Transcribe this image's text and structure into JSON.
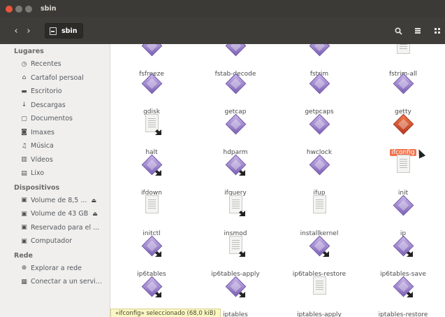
{
  "window": {
    "title": "sbin"
  },
  "toolbar": {
    "path_label": "sbin"
  },
  "sidebar": {
    "sections": [
      {
        "title": "Lugares",
        "items": [
          {
            "label": "Recentes",
            "icon": "clock-icon"
          },
          {
            "label": "Cartafol persoal",
            "icon": "home-icon"
          },
          {
            "label": "Escritorio",
            "icon": "desktop-icon"
          },
          {
            "label": "Descargas",
            "icon": "download-icon"
          },
          {
            "label": "Documentos",
            "icon": "document-icon"
          },
          {
            "label": "Imaxes",
            "icon": "camera-icon"
          },
          {
            "label": "Música",
            "icon": "music-icon"
          },
          {
            "label": "Vídeos",
            "icon": "film-icon"
          },
          {
            "label": "Lixo",
            "icon": "trash-icon"
          }
        ]
      },
      {
        "title": "Dispositivos",
        "items": [
          {
            "label": "Volume de 8,5 ...",
            "icon": "drive-icon",
            "eject": true
          },
          {
            "label": "Volume de 43 GB",
            "icon": "drive-icon",
            "eject": true
          },
          {
            "label": "Reservado para el ...",
            "icon": "drive-icon"
          },
          {
            "label": "Computador",
            "icon": "computer-icon"
          }
        ]
      },
      {
        "title": "Rede",
        "items": [
          {
            "label": "Explorar a rede",
            "icon": "network-icon"
          },
          {
            "label": "Conectar a un servi...",
            "icon": "server-icon"
          }
        ]
      }
    ]
  },
  "files": [
    {
      "name": "fsfreeze",
      "type": "exec"
    },
    {
      "name": "fstab-decode",
      "type": "exec"
    },
    {
      "name": "fstrim",
      "type": "exec"
    },
    {
      "name": "fstrim-all",
      "type": "script"
    },
    {
      "name": "gdisk",
      "type": "exec"
    },
    {
      "name": "getcap",
      "type": "exec"
    },
    {
      "name": "getpcaps",
      "type": "exec"
    },
    {
      "name": "getty",
      "type": "exec"
    },
    {
      "name": "halt",
      "type": "link"
    },
    {
      "name": "hdparm",
      "type": "exec"
    },
    {
      "name": "hwclock",
      "type": "exec"
    },
    {
      "name": "ifconfig",
      "type": "exec",
      "selected": true
    },
    {
      "name": "ifdown",
      "type": "exec-link"
    },
    {
      "name": "ifquery",
      "type": "exec-link"
    },
    {
      "name": "ifup",
      "type": "exec"
    },
    {
      "name": "init",
      "type": "script"
    },
    {
      "name": "initctl",
      "type": "script"
    },
    {
      "name": "insmod",
      "type": "link"
    },
    {
      "name": "installkernel",
      "type": "script"
    },
    {
      "name": "ip",
      "type": "exec"
    },
    {
      "name": "ip6tables",
      "type": "exec-link"
    },
    {
      "name": "ip6tables-apply",
      "type": "link"
    },
    {
      "name": "ip6tables-restore",
      "type": "exec-link"
    },
    {
      "name": "ip6tables-save",
      "type": "exec-link"
    },
    {
      "name": "",
      "type": "exec-link"
    },
    {
      "name": "iptables",
      "type": "exec-link"
    },
    {
      "name": "iptables-apply",
      "type": "script"
    },
    {
      "name": "iptables-restore",
      "type": "exec-link"
    }
  ],
  "status": {
    "text": "«ifconfig» seleccionado (68,0 kiB)"
  },
  "colors": {
    "accent": "#f0734d",
    "titlebar": "#3b3a36",
    "sidebar": "#f0efed"
  }
}
